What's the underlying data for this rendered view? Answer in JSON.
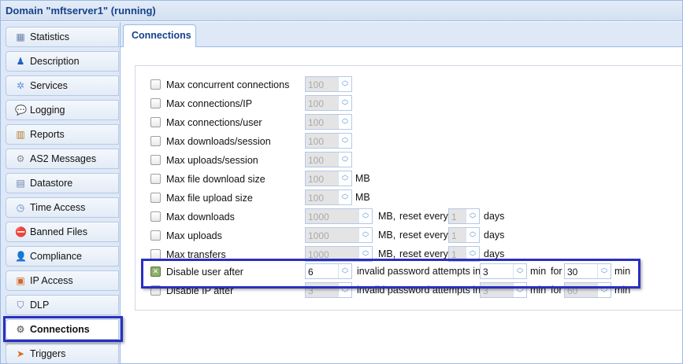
{
  "window": {
    "title": "Domain \"mftserver1\" (running)"
  },
  "sidebar": {
    "items": [
      {
        "label": "Statistics",
        "icon": "statistics-icon",
        "glyph": "▦",
        "color": "#6a7fa8"
      },
      {
        "label": "Description",
        "icon": "user-icon",
        "glyph": "♟",
        "color": "#1d5fbf"
      },
      {
        "label": "Services",
        "icon": "services-icon",
        "glyph": "✲",
        "color": "#5a8fd6"
      },
      {
        "label": "Logging",
        "icon": "logging-icon",
        "glyph": "💬",
        "color": "#8a8fb0"
      },
      {
        "label": "Reports",
        "icon": "reports-icon",
        "glyph": "▥",
        "color": "#b07a2a"
      },
      {
        "label": "AS2 Messages",
        "icon": "as2-messages-icon",
        "glyph": "⚙",
        "color": "#8a8a8a"
      },
      {
        "label": "Datastore",
        "icon": "datastore-icon",
        "glyph": "▤",
        "color": "#6a7fa8"
      },
      {
        "label": "Time Access",
        "icon": "time-access-icon",
        "glyph": "◷",
        "color": "#5a7fb0"
      },
      {
        "label": "Banned Files",
        "icon": "banned-files-icon",
        "glyph": "⛔",
        "color": "#d03a2a"
      },
      {
        "label": "Compliance",
        "icon": "compliance-icon",
        "glyph": "👤",
        "color": "#1d5fbf"
      },
      {
        "label": "IP Access",
        "icon": "ip-access-icon",
        "glyph": "▣",
        "color": "#d06a2a"
      },
      {
        "label": "DLP",
        "icon": "dlp-icon",
        "glyph": "⛉",
        "color": "#6a6aa8"
      },
      {
        "label": "Connections",
        "icon": "connections-icon",
        "glyph": "⚙",
        "color": "#7a7a7a",
        "active": true
      },
      {
        "label": "Triggers",
        "icon": "triggers-icon",
        "glyph": "➤",
        "color": "#e06a1a"
      }
    ]
  },
  "tab": {
    "label": "Connections"
  },
  "limits": [
    {
      "label": "Max concurrent connections",
      "value": "100",
      "checked": false
    },
    {
      "label": "Max connections/IP",
      "value": "100",
      "checked": false
    },
    {
      "label": "Max connections/user",
      "value": "100",
      "checked": false
    },
    {
      "label": "Max downloads/session",
      "value": "100",
      "checked": false
    },
    {
      "label": "Max uploads/session",
      "value": "100",
      "checked": false
    },
    {
      "label": "Max file download size",
      "value": "100",
      "unit": "MB",
      "checked": false
    },
    {
      "label": "Max file upload size",
      "value": "100",
      "unit": "MB",
      "checked": false
    },
    {
      "label": "Max downloads",
      "value": "1000",
      "unit": "MB,",
      "reset_label": "reset every",
      "reset_value": "1",
      "reset_unit": "days",
      "checked": false
    },
    {
      "label": "Max uploads",
      "value": "1000",
      "unit": "MB,",
      "reset_label": "reset every",
      "reset_value": "1",
      "reset_unit": "days",
      "checked": false
    },
    {
      "label": "Max transfers",
      "value": "1000",
      "unit": "MB,",
      "reset_label": "reset every",
      "reset_value": "1",
      "reset_unit": "days",
      "checked": false
    }
  ],
  "lockouts": [
    {
      "label": "Disable user after",
      "attempts": "6",
      "text": "invalid password attempts in",
      "window": "3",
      "min1": "min",
      "for": "for",
      "duration": "30",
      "min2": "min",
      "checked": true
    },
    {
      "label": "Disable IP after",
      "attempts": "3",
      "text": "invalid password attempts in",
      "window": "3",
      "min1": "min",
      "for": "for",
      "duration": "60",
      "min2": "min",
      "checked": false
    }
  ],
  "highlight_color": "#2b2fbf"
}
